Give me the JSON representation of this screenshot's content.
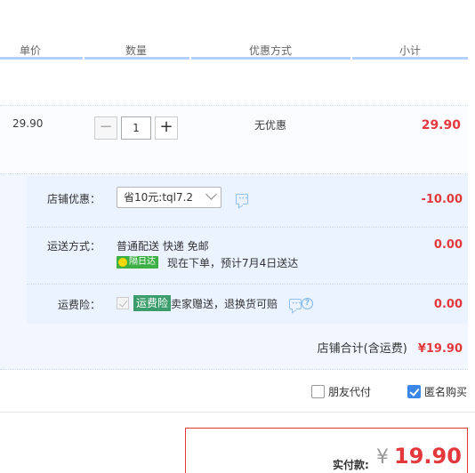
{
  "header": {
    "columns": [
      "单价",
      "数量",
      "优惠方式",
      "小计"
    ]
  },
  "item": {
    "unit_price": "29.90",
    "quantity": "1",
    "minus_label": "−",
    "plus_label": "+",
    "promotion": "无优惠",
    "subtotal": "29.90"
  },
  "shop": {
    "coupon": {
      "label": "店铺优惠：",
      "selected": "省10元:tql7.2",
      "amount": "-10.00"
    },
    "shipping": {
      "label": "运送方式：",
      "method": "普通配送 快递 免邮",
      "badge": "隔日达",
      "eta": "现在下单，预计7月4日送达",
      "amount": "0.00"
    },
    "insurance": {
      "label": "运费险：",
      "badge": "运费险",
      "text": "卖家赠送，退换货可赔",
      "amount": "0.00"
    },
    "total": {
      "label": "店铺合计(含运费)",
      "value": "¥19.90"
    }
  },
  "options": {
    "friend_pay": "朋友代付",
    "anonymous": "匿名购买"
  },
  "payment": {
    "label": "实付款:",
    "currency": "¥",
    "value": "19.90"
  },
  "colors": {
    "accent": "#e4393c",
    "header_line": "#b2d1ff",
    "checkbox_on": "#3a87e8"
  }
}
